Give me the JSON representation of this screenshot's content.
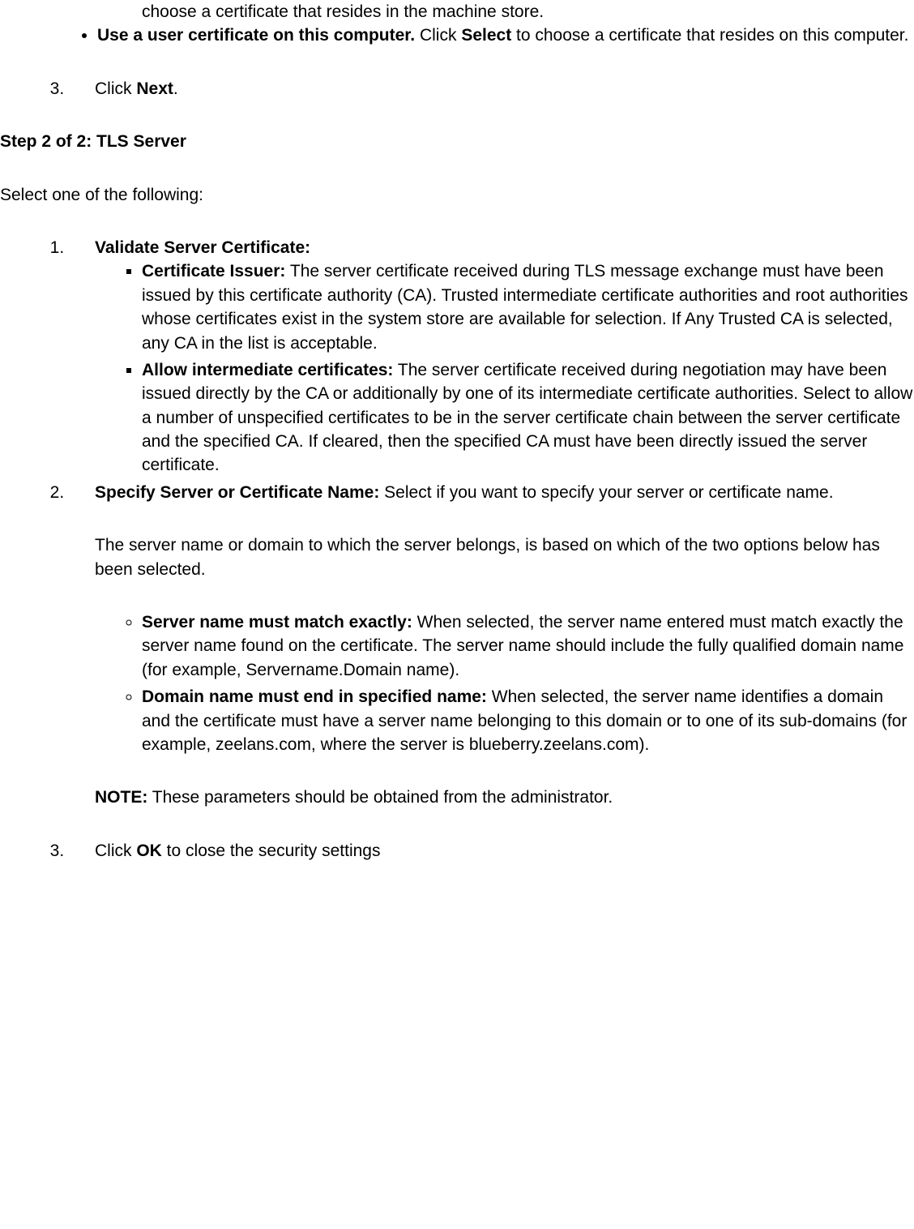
{
  "top": {
    "line1": "choose a certificate that resides in the machine store.",
    "bullet_label": "Use a user certificate on this computer.",
    "bullet_text": " Click ",
    "bullet_select": "Select",
    "bullet_tail": " to choose a certificate that resides on this computer.",
    "step3_click": "Click ",
    "step3_next": "Next",
    "step3_period": "."
  },
  "heading": "Step 2 of 2: TLS Server",
  "intro": "Select one of the following:",
  "list": {
    "item1": {
      "title": "Validate Server Certificate:",
      "sub1_label": "Certificate Issuer:",
      "sub1_text": " The server certificate received during TLS message exchange must have been issued by this certificate authority (CA). Trusted intermediate certificate authorities and root authorities whose certificates exist in the system store are available for selection. If Any Trusted CA is selected, any CA in the list is acceptable.",
      "sub2_label": "Allow intermediate certificates:",
      "sub2_text": " The server certificate received during negotiation may have been issued directly by the CA or additionally by one of its intermediate certificate authorities. Select to allow a number of unspecified certificates to be in the server certificate chain between the server certificate and the specified CA. If cleared, then the specified CA must have been directly issued the server certificate."
    },
    "item2": {
      "title": "Specify Server or Certificate Name:",
      "text": " Select if you want to specify your server or certificate name.",
      "para": "The server name or domain to which the server belongs, is based on which of the two options below has been selected.",
      "sub1_label": "Server name must match exactly:",
      "sub1_text": " When selected, the server name entered must match exactly the server name found on the certificate. The server name should include the fully qualified domain name (for example, Servername.Domain name).",
      "sub2_label": "Domain name must end in specified name:",
      "sub2_text": " When selected, the server name identifies a domain and the certificate must have a server name belonging to this domain or to one of its sub-domains (for example, zeelans.com, where the server is blueberry.zeelans.com).",
      "note_label": "NOTE:",
      "note_text": " These parameters should be obtained from the administrator."
    },
    "item3_click": "Click ",
    "item3_ok": "OK",
    "item3_tail": " to close the security settings"
  }
}
